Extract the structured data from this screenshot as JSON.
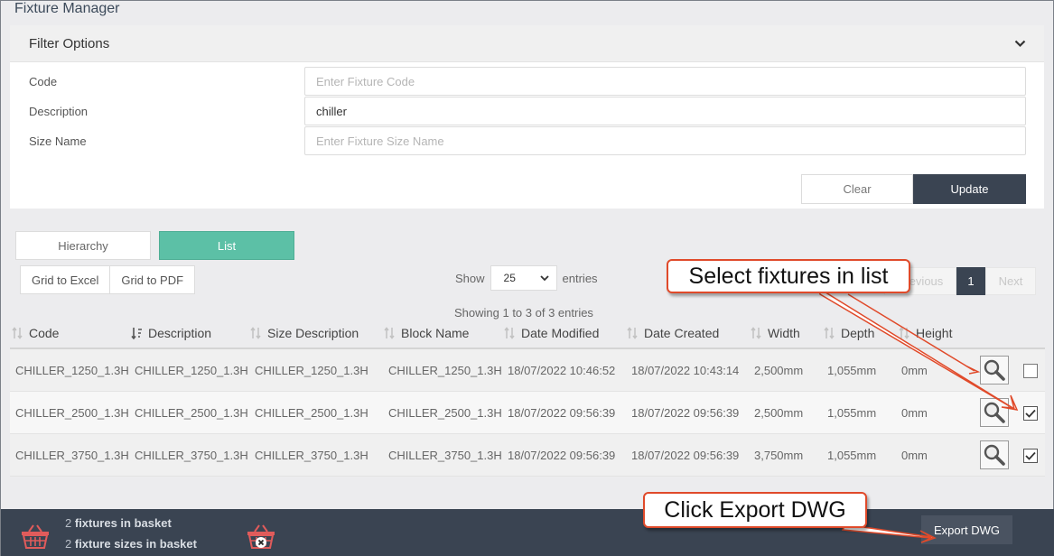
{
  "app": {
    "title": "Fixture Manager"
  },
  "filter": {
    "header": "Filter Options",
    "fields": [
      {
        "label": "Code",
        "value": "",
        "placeholder": "Enter Fixture Code"
      },
      {
        "label": "Description",
        "value": "chiller",
        "placeholder": ""
      },
      {
        "label": "Size Name",
        "value": "",
        "placeholder": "Enter Fixture Size Name"
      }
    ],
    "clear_label": "Clear",
    "update_label": "Update"
  },
  "view": {
    "hierarchy_label": "Hierarchy",
    "list_label": "List"
  },
  "grid_export": {
    "excel_label": "Grid to Excel",
    "pdf_label": "Grid to PDF"
  },
  "length": {
    "show_label": "Show",
    "selected": "25",
    "entries_label": "entries"
  },
  "info": "Showing 1 to 3 of 3 entries",
  "pagination": {
    "previous": "Previous",
    "current": "1",
    "next": "Next"
  },
  "table": {
    "columns": [
      "Code",
      "Description",
      "Size Description",
      "Block Name",
      "Date Modified",
      "Date Created",
      "Width",
      "Depth",
      "Height"
    ],
    "rows": [
      {
        "code": "CHILLER_1250_1.3H",
        "description": "CHILLER_1250_1.3H",
        "size_description": "CHILLER_1250_1.3H",
        "block_name": "CHILLER_1250_1.3H",
        "date_modified": "18/07/2022 10:46:52",
        "date_created": "18/07/2022 10:43:14",
        "width": "2,500mm",
        "depth": "1,055mm",
        "height": "0mm",
        "selected": false
      },
      {
        "code": "CHILLER_2500_1.3H",
        "description": "CHILLER_2500_1.3H",
        "size_description": "CHILLER_2500_1.3H",
        "block_name": "CHILLER_2500_1.3H",
        "date_modified": "18/07/2022 09:56:39",
        "date_created": "18/07/2022 09:56:39",
        "width": "2,500mm",
        "depth": "1,055mm",
        "height": "0mm",
        "selected": true
      },
      {
        "code": "CHILLER_3750_1.3H",
        "description": "CHILLER_3750_1.3H",
        "size_description": "CHILLER_3750_1.3H",
        "block_name": "CHILLER_3750_1.3H",
        "date_modified": "18/07/2022 09:56:39",
        "date_created": "18/07/2022 09:56:39",
        "width": "3,750mm",
        "depth": "1,055mm",
        "height": "0mm",
        "selected": true
      }
    ]
  },
  "footer": {
    "fixtures_count": "2",
    "fixtures_label": "fixtures in basket",
    "sizes_count": "2",
    "sizes_label": "fixture sizes in basket",
    "export_label": "Export DWG"
  },
  "callouts": {
    "select": "Select fixtures in list",
    "export": "Click Export DWG"
  },
  "colors": {
    "accent": "#5cc0a6",
    "dark": "#3a4452",
    "callout_border": "#e04a2a",
    "basket": "#e05b5b"
  }
}
